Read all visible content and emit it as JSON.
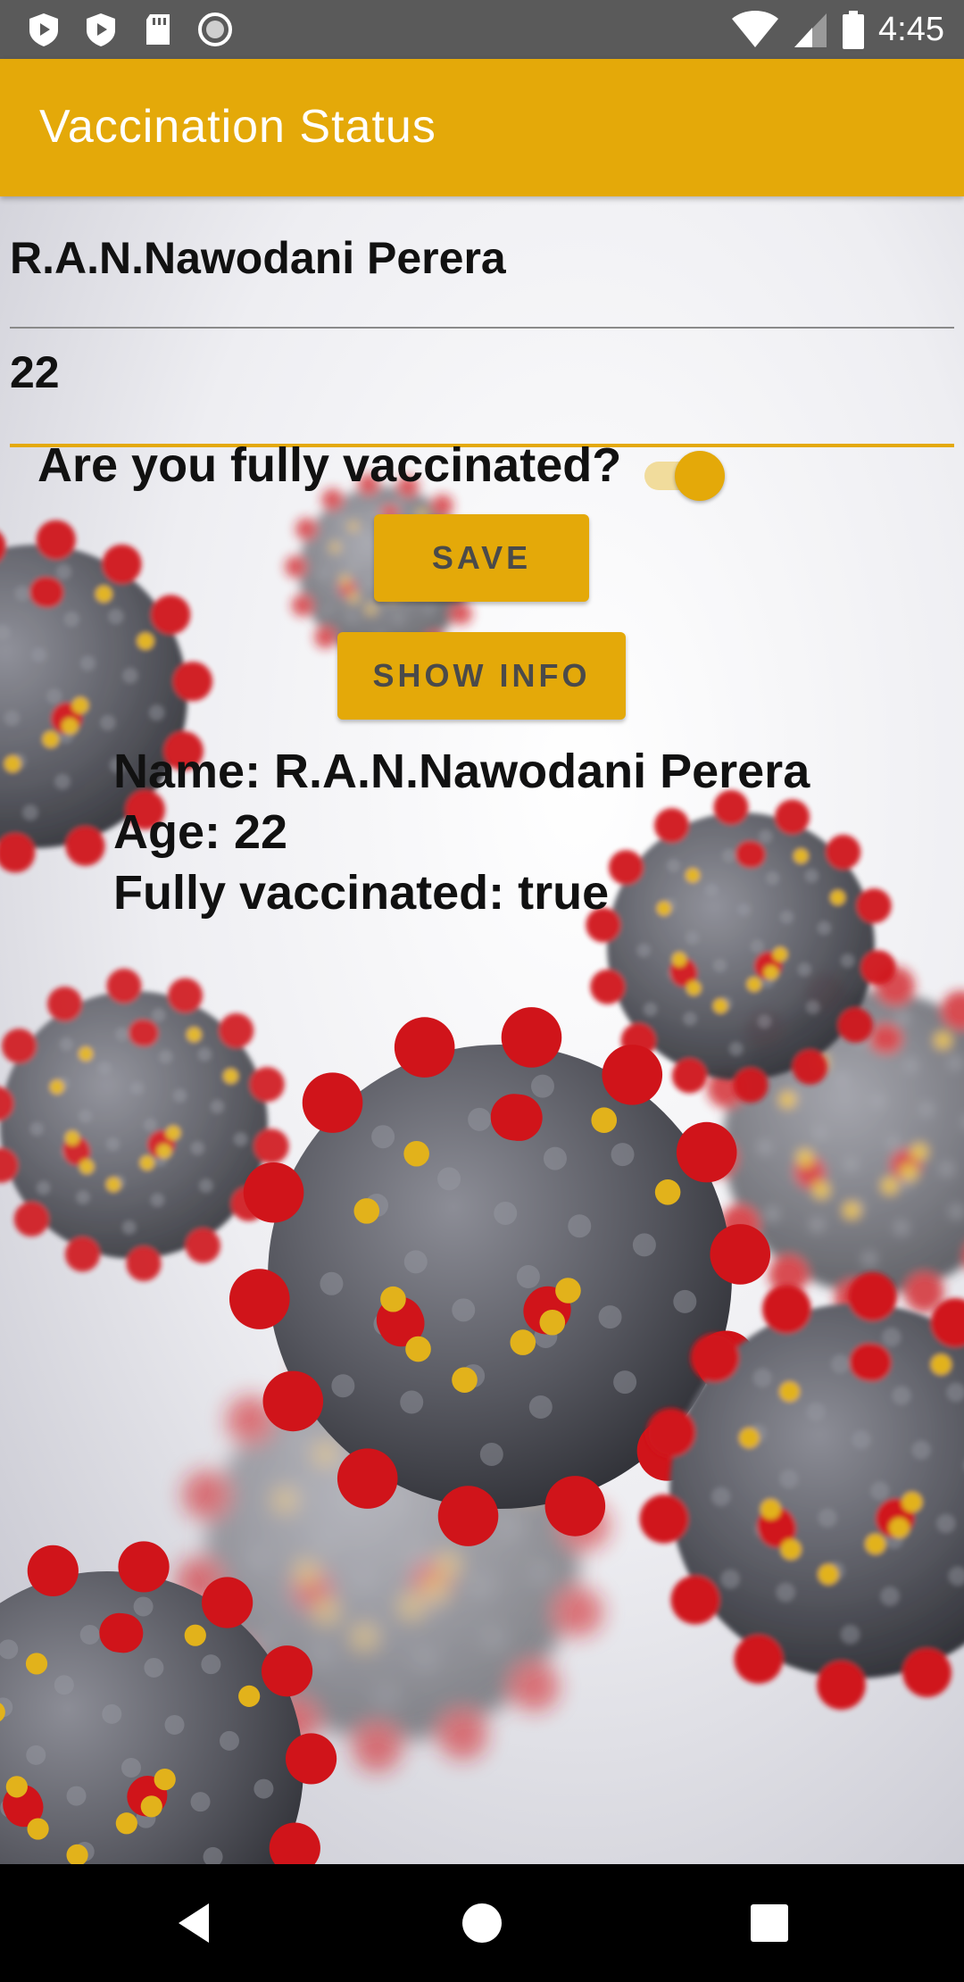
{
  "status_bar": {
    "time": "4:45",
    "left_icons": [
      "shield-play-icon",
      "shield-play-icon",
      "sd-card-icon",
      "circle-record-icon"
    ],
    "right_icons": [
      "wifi-icon",
      "signal-icon",
      "battery-icon"
    ]
  },
  "app_bar": {
    "title": "Vaccination Status"
  },
  "form": {
    "name_value": "R.A.N.Nawodani Perera",
    "age_value": "22",
    "question_label": "Are you fully vaccinated?",
    "vaccinated_switch_on": true,
    "save_label": "SAVE",
    "show_info_label": "SHOW INFO"
  },
  "info": {
    "name_line": "Name: R.A.N.Nawodani Perera",
    "age_line": "Age: 22",
    "vaccinated_line": "Fully vaccinated: true"
  },
  "nav_bar": {
    "icons": [
      "back-icon",
      "home-icon",
      "recents-icon"
    ]
  },
  "colors": {
    "accent": "#E4A909",
    "status_bar": "#5a5a5a",
    "nav_bar": "#000000",
    "virus_body": "#55565e",
    "virus_spike_red": "#d0141a",
    "virus_spike_yellow": "#e2b21b"
  }
}
